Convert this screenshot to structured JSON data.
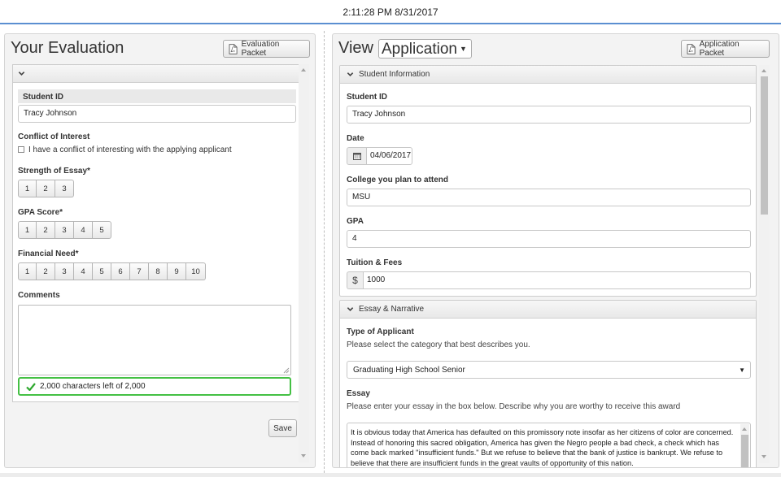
{
  "header": {
    "timestamp": "2:11:28 PM 8/31/2017"
  },
  "evaluation": {
    "title": "Your Evaluation",
    "packet_button": "Evaluation Packet",
    "student_id_label": "Student ID",
    "student_id_value": "Tracy Johnson",
    "conflict_label": "Conflict of Interest",
    "conflict_checkbox_label": "I have a conflict of interesting with the applying applicant",
    "essay_strength_label": "Strength of Essay*",
    "essay_strength_options": [
      "1",
      "2",
      "3"
    ],
    "gpa_label": "GPA Score*",
    "gpa_options": [
      "1",
      "2",
      "3",
      "4",
      "5"
    ],
    "financial_label": "Financial Need*",
    "financial_options": [
      "1",
      "2",
      "3",
      "4",
      "5",
      "6",
      "7",
      "8",
      "9",
      "10"
    ],
    "comments_label": "Comments",
    "comments_value": "",
    "char_count": "2,000 characters left of 2,000",
    "save_label": "Save"
  },
  "application": {
    "view_label": "View",
    "view_select": "Application",
    "packet_button": "Application Packet",
    "student_info_header": "Student Information",
    "student_id_label": "Student ID",
    "student_id_value": "Tracy Johnson",
    "date_label": "Date",
    "date_value": "04/06/2017",
    "college_label": "College you plan to attend",
    "college_value": "MSU",
    "gpa_label": "GPA",
    "gpa_value": "4",
    "tuition_label": "Tuition & Fees",
    "tuition_currency": "$",
    "tuition_value": "1000",
    "essay_header": "Essay & Narrative",
    "type_label": "Type of Applicant",
    "type_help": "Please select the category that best describes you.",
    "type_value": "Graduating High School Senior",
    "essay_label": "Essay",
    "essay_help": "Please enter your essay in the box below. Describe why you are worthy to receive this award",
    "essay_text": "It is obvious today that America has defaulted on this promissory note insofar as her citizens of color are concerned. Instead of honoring this sacred obligation, America has given the Negro people a bad check, a check which has come back marked \"insufficient funds.\" But we refuse to believe that the bank of justice is bankrupt. We refuse to believe that there are insufficient funds in the great vaults of opportunity of this nation."
  },
  "colors": {
    "accent": "#5b8fd1",
    "success": "#44c044"
  }
}
